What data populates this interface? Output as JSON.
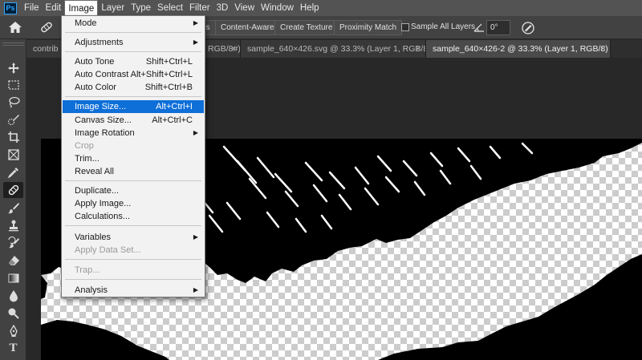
{
  "menubar": {
    "logo": "Ps",
    "items": [
      "File",
      "Edit",
      "Image",
      "Layer",
      "Type",
      "Select",
      "Filter",
      "3D",
      "View",
      "Window",
      "Help"
    ],
    "active": "Image"
  },
  "options": {
    "buttons": [
      "es",
      "Content-Aware",
      "Create Texture",
      "Proximity Match"
    ],
    "sample_all_layers": "Sample All Layers",
    "angle_value": "0°"
  },
  "tabs": [
    {
      "label": "contrib",
      "active": false
    },
    {
      "label": "RGB/8#)",
      "active": false
    },
    {
      "label": "sample_640×426.svg @ 33.3% (Layer 1, RGB/8)",
      "active": false
    },
    {
      "label": "sample_640×426-2 @ 33.3% (Layer 1, RGB/8)",
      "active": true
    }
  ],
  "tab_close": "×",
  "image_menu": {
    "mode": {
      "label": "Mode",
      "submenu": true
    },
    "adjustments": {
      "label": "Adjustments",
      "submenu": true
    },
    "auto_tone": {
      "label": "Auto Tone",
      "shortcut": "Shift+Ctrl+L"
    },
    "auto_contrast": {
      "label": "Auto Contrast",
      "shortcut": "Alt+Shift+Ctrl+L"
    },
    "auto_color": {
      "label": "Auto Color",
      "shortcut": "Shift+Ctrl+B"
    },
    "image_size": {
      "label": "Image Size...",
      "shortcut": "Alt+Ctrl+I",
      "highlighted": true
    },
    "canvas_size": {
      "label": "Canvas Size...",
      "shortcut": "Alt+Ctrl+C"
    },
    "image_rotation": {
      "label": "Image Rotation",
      "submenu": true
    },
    "crop": {
      "label": "Crop",
      "disabled": true
    },
    "trim": {
      "label": "Trim..."
    },
    "reveal_all": {
      "label": "Reveal All"
    },
    "duplicate": {
      "label": "Duplicate..."
    },
    "apply_image": {
      "label": "Apply Image..."
    },
    "calculations": {
      "label": "Calculations..."
    },
    "variables": {
      "label": "Variables",
      "submenu": true
    },
    "apply_data_set": {
      "label": "Apply Data Set...",
      "disabled": true
    },
    "trap": {
      "label": "Trap...",
      "disabled": true
    },
    "analysis": {
      "label": "Analysis",
      "submenu": true
    },
    "submenu_arrow": "▶"
  },
  "tools": [
    "move-tool",
    "marquee-tool",
    "lasso-tool",
    "quick-selection-tool",
    "crop-tool",
    "frame-tool",
    "eyedropper-tool",
    "healing-brush-tool",
    "brush-tool",
    "clone-stamp-tool",
    "history-brush-tool",
    "eraser-tool",
    "gradient-tool",
    "blur-tool",
    "dodge-tool",
    "pen-tool",
    "type-tool"
  ],
  "active_tool": "healing-brush-tool",
  "type_tool_glyph": "T",
  "colors": {
    "menubar": "#535353",
    "panel": "#424242",
    "workspace": "#282828",
    "menu_bg": "#f2f2f2",
    "highlight": "#0e6fd8"
  }
}
